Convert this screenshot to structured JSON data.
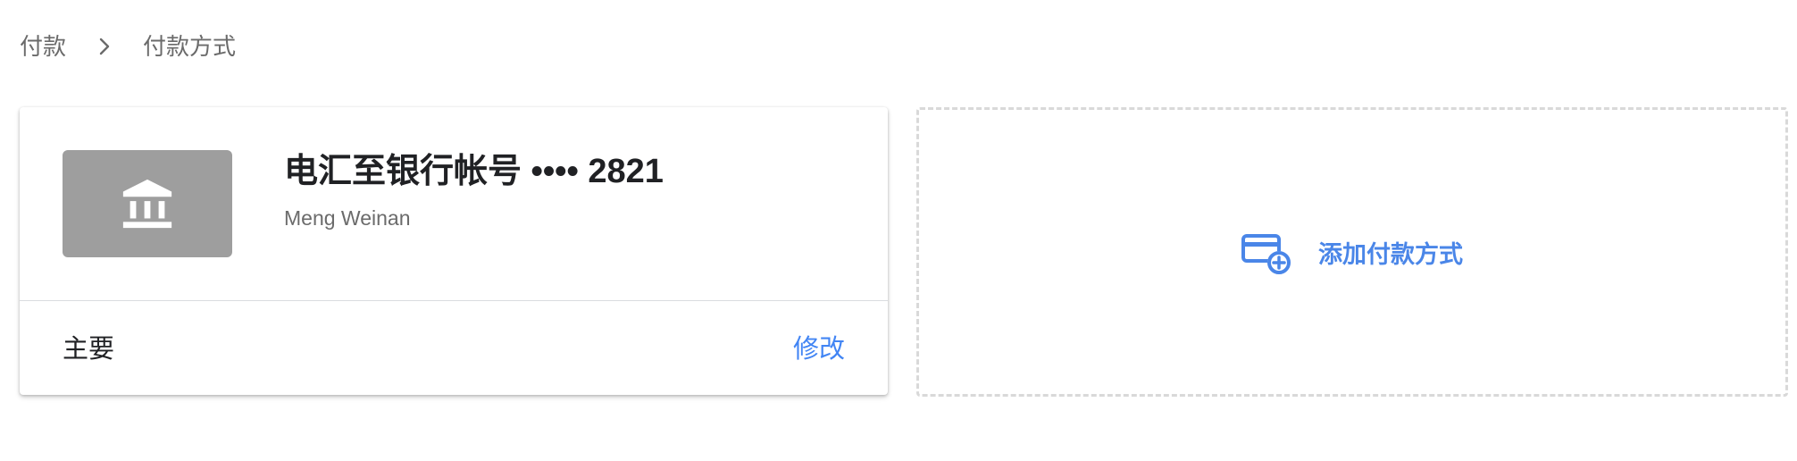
{
  "breadcrumb": {
    "items": [
      "付款",
      "付款方式"
    ]
  },
  "payment_method": {
    "title": "电汇至银行帐号 •••• 2821",
    "holder": "Meng Weinan",
    "status": "主要",
    "edit_label": "修改",
    "icon": "bank-icon"
  },
  "add_method": {
    "label": "添加付款方式",
    "icon": "add-card-icon"
  },
  "colors": {
    "link": "#4285f4",
    "tile": "#9e9e9e",
    "muted_text": "#6b6b6b",
    "dashed_border": "#d9d9d9"
  }
}
